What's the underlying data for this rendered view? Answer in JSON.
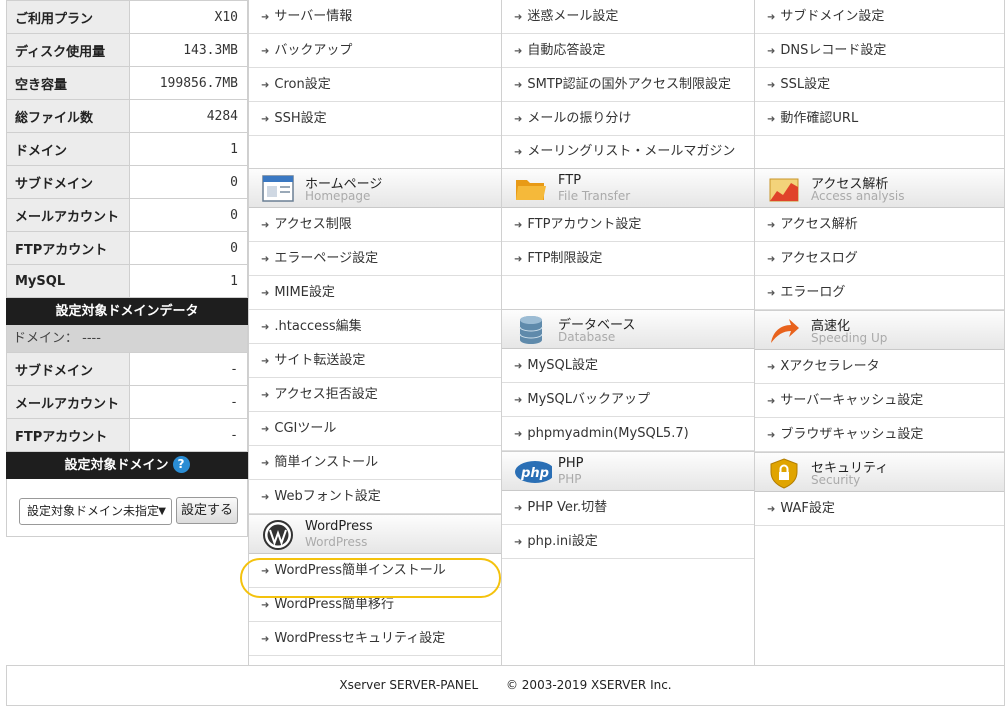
{
  "sidebar": {
    "stats": [
      {
        "label": "ご利用プラン",
        "value": "X10"
      },
      {
        "label": "ディスク使用量",
        "value": "143.3MB"
      },
      {
        "label": "空き容量",
        "value": "199856.7MB"
      },
      {
        "label": "総ファイル数",
        "value": "4284"
      },
      {
        "label": "ドメイン",
        "value": "1"
      },
      {
        "label": "サブドメイン",
        "value": "0"
      },
      {
        "label": "メールアカウント",
        "value": "0"
      },
      {
        "label": "FTPアカウント",
        "value": "0"
      },
      {
        "label": "MySQL",
        "value": "1"
      }
    ],
    "target_data_heading": "設定対象ドメインデータ",
    "domain_line": "ドメイン： ----",
    "target_stats": [
      {
        "label": "サブドメイン",
        "value": "-"
      },
      {
        "label": "メールアカウント",
        "value": "-"
      },
      {
        "label": "FTPアカウント",
        "value": "-"
      }
    ],
    "target_domain_heading": "設定対象ドメイン",
    "help_label": "?",
    "domain_select_value": "設定対象ドメイン未指定",
    "set_button_label": "設定する"
  },
  "columns": {
    "col1": {
      "top_items": [
        "サーバー情報",
        "バックアップ",
        "Cron設定",
        "SSH設定"
      ],
      "homepage": {
        "title": "ホームページ",
        "subtitle": "Homepage",
        "items": [
          "アクセス制限",
          "エラーページ設定",
          "MIME設定",
          ".htaccess編集",
          "サイト転送設定",
          "アクセス拒否設定",
          "CGIツール",
          "簡単インストール",
          "Webフォント設定"
        ]
      },
      "wordpress": {
        "title": "WordPress",
        "subtitle": "WordPress",
        "items": [
          "WordPress簡単インストール",
          "WordPress簡単移行",
          "WordPressセキュリティ設定"
        ]
      }
    },
    "col2": {
      "top_items": [
        "迷惑メール設定",
        "自動応答設定",
        "SMTP認証の国外アクセス制限設定",
        "メールの振り分け",
        "メーリングリスト・メールマガジン"
      ],
      "ftp": {
        "title": "FTP",
        "subtitle": "File Transfer",
        "items": [
          "FTPアカウント設定",
          "FTP制限設定"
        ]
      },
      "database": {
        "title": "データベース",
        "subtitle": "Database",
        "items": [
          "MySQL設定",
          "MySQLバックアップ",
          "phpmyadmin(MySQL5.7)"
        ]
      },
      "php": {
        "title": "PHP",
        "subtitle": "PHP",
        "icon_text": "php",
        "items": [
          "PHP Ver.切替",
          "php.ini設定"
        ]
      }
    },
    "col3": {
      "top_items": [
        "サブドメイン設定",
        "DNSレコード設定",
        "SSL設定",
        "動作確認URL"
      ],
      "access": {
        "title": "アクセス解析",
        "subtitle": "Access analysis",
        "items": [
          "アクセス解析",
          "アクセスログ",
          "エラーログ"
        ]
      },
      "speed": {
        "title": "高速化",
        "subtitle": "Speeding Up",
        "items": [
          "Xアクセラレータ",
          "サーバーキャッシュ設定",
          "ブラウザキャッシュ設定"
        ]
      },
      "security": {
        "title": "セキュリティ",
        "subtitle": "Security",
        "items": [
          "WAF設定"
        ]
      }
    }
  },
  "footer": {
    "product": "Xserver SERVER-PANEL",
    "copyright": "© 2003-2019 XSERVER Inc."
  },
  "colors": {
    "highlight": "#f4c20d",
    "ftp_folder": "#f0a020",
    "php_badge": "#2a6fb5",
    "speed_arrow": "#e8621c",
    "security_shield": "#e0a400"
  }
}
